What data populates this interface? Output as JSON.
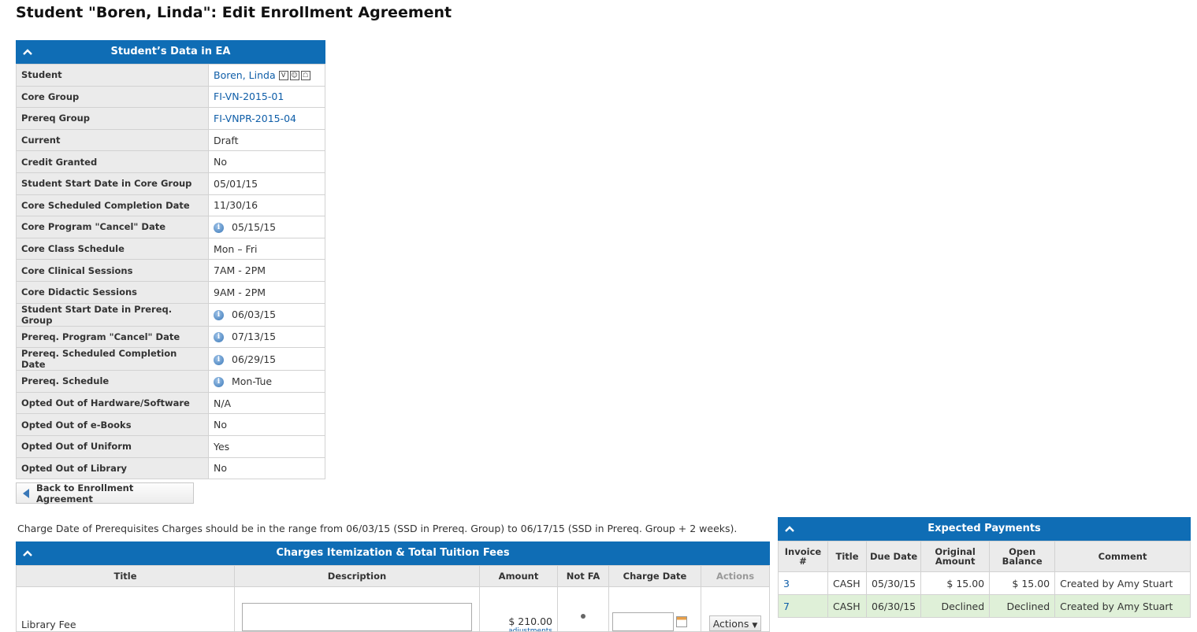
{
  "page_title": "Student \"Boren, Linda\": Edit Enrollment Agreement",
  "ea_panel": {
    "title": "Student’s Data in EA",
    "rows": [
      {
        "label": "Student",
        "value": "Boren, Linda",
        "link": true,
        "badges": [
          "V",
          "☺",
          "☖"
        ]
      },
      {
        "label": "Core Group",
        "value": "FI-VN-2015-01",
        "link": true
      },
      {
        "label": "Prereq Group",
        "value": "FI-VNPR-2015-04",
        "link": true
      },
      {
        "label": "Current",
        "value": "Draft"
      },
      {
        "label": "Credit Granted",
        "value": "No"
      },
      {
        "label": "Student Start Date in Core Group",
        "value": "05/01/15"
      },
      {
        "label": "Core Scheduled Completion Date",
        "value": "11/30/16"
      },
      {
        "label": "Core Program \"Cancel\" Date",
        "value": "05/15/15",
        "info": true
      },
      {
        "label": "Core Class Schedule",
        "value": "Mon – Fri"
      },
      {
        "label": "Core Clinical Sessions",
        "value": "7AM - 2PM"
      },
      {
        "label": "Core Didactic Sessions",
        "value": "9AM - 2PM"
      },
      {
        "label": "Student Start Date in Prereq. Group",
        "value": "06/03/15",
        "info": true
      },
      {
        "label": "Prereq. Program \"Cancel\" Date",
        "value": "07/13/15",
        "info": true
      },
      {
        "label": "Prereq. Scheduled Completion Date",
        "value": "06/29/15",
        "info": true
      },
      {
        "label": "Prereq. Schedule",
        "value": "Mon-Tue",
        "info": true
      },
      {
        "label": "Opted Out of Hardware/Software",
        "value": "N/A"
      },
      {
        "label": "Opted Out of e-Books",
        "value": "No"
      },
      {
        "label": "Opted Out of Uniform",
        "value": "Yes"
      },
      {
        "label": "Opted Out of Library",
        "value": "No"
      }
    ]
  },
  "back_button": "Back to Enrollment Agreement",
  "charge_note": "Charge Date of Prerequisites Charges should be in the range from 06/03/15 (SSD in Prereq. Group) to 06/17/15 (SSD in Prereq. Group + 2 weeks).",
  "charges": {
    "title": "Charges Itemization & Total Tuition Fees",
    "columns": [
      "Title",
      "Description",
      "Amount",
      "Not FA",
      "Charge Date",
      "Actions"
    ],
    "rows": [
      {
        "title": "Library Fee",
        "amount": "$ 210.00",
        "adjustments": "adjustments",
        "actions": "Actions"
      }
    ]
  },
  "payments": {
    "title": "Expected Payments",
    "columns": [
      "Invoice #",
      "Title",
      "Due Date",
      "Original Amount",
      "Open Balance",
      "Comment"
    ],
    "rows": [
      {
        "invoice": "3",
        "title": "CASH",
        "due": "05/30/15",
        "original": "$ 15.00",
        "open": "$ 15.00",
        "comment": "Created by Amy Stuart"
      },
      {
        "invoice": "7",
        "title": "CASH",
        "due": "06/30/15",
        "original": "Declined",
        "open": "Declined",
        "comment": "Created by Amy Stuart"
      }
    ]
  },
  "colors": {
    "header_blue": "#0f6db5",
    "link": "#0f5ea8",
    "label_bg": "#ebebeb",
    "row_green": "#dff0d8"
  }
}
